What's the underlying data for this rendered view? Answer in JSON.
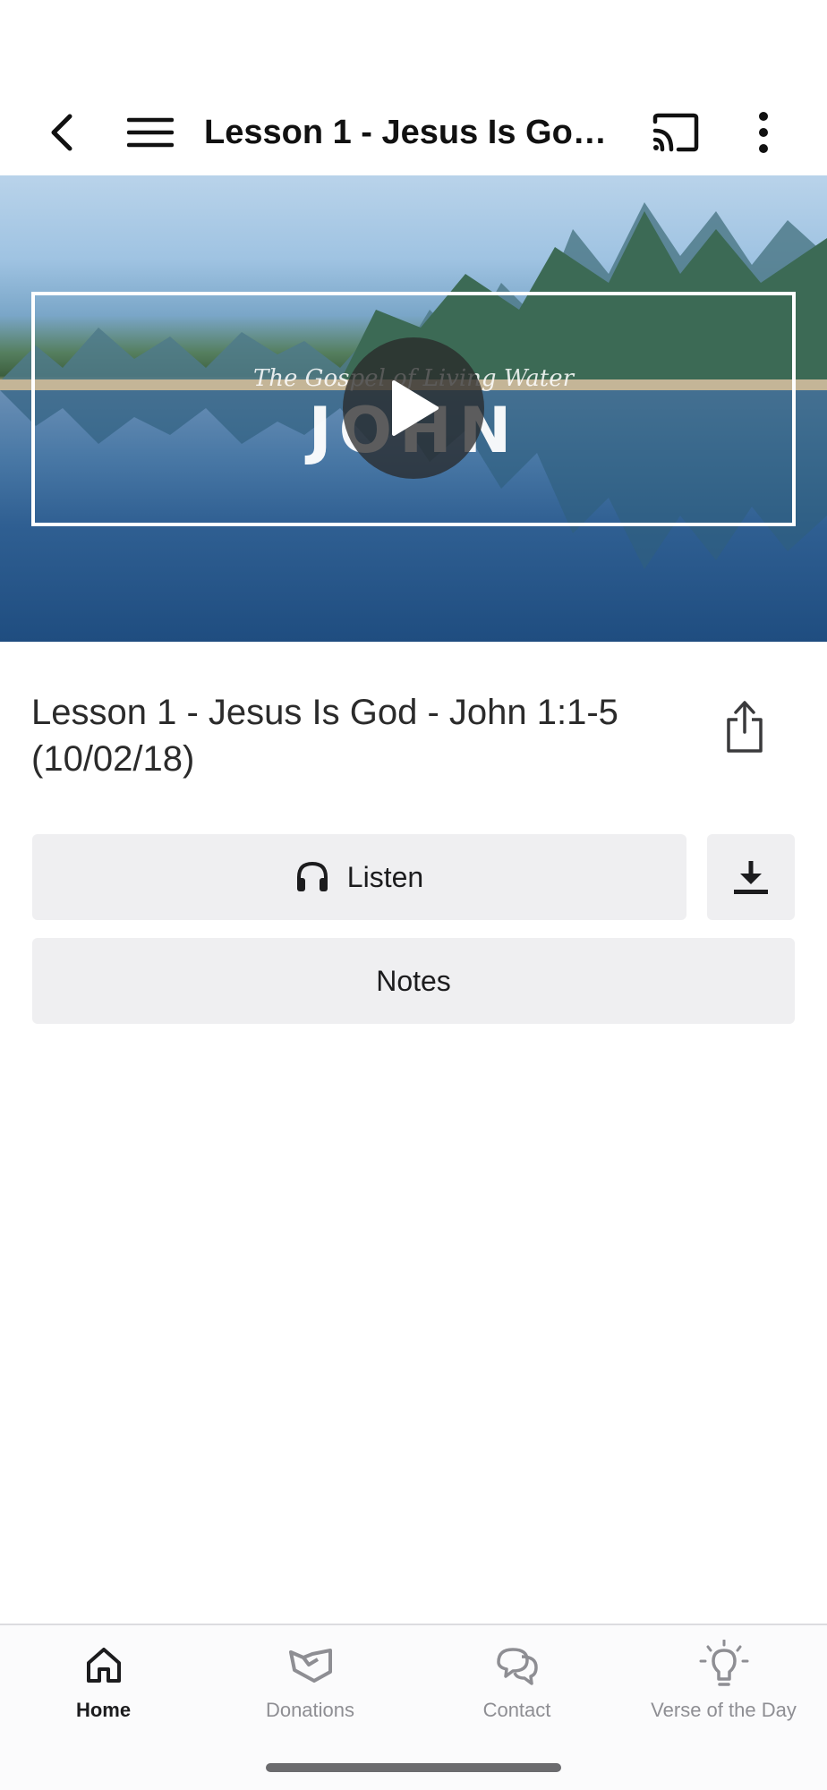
{
  "header": {
    "title": "Lesson 1 - Jesus Is God..."
  },
  "hero": {
    "subtitle": "The Gospel of Living Water",
    "title": "JOHN"
  },
  "lesson": {
    "title": "Lesson 1 - Jesus Is God - John 1:1-5 (10/02/18)"
  },
  "actions": {
    "listen_label": "Listen",
    "notes_label": "Notes"
  },
  "tabs": [
    {
      "label": "Home",
      "icon": "home-icon",
      "active": true
    },
    {
      "label": "Donations",
      "icon": "handshake-icon",
      "active": false
    },
    {
      "label": "Contact",
      "icon": "chat-bubbles-icon",
      "active": false
    },
    {
      "label": "Verse of the Day",
      "icon": "lightbulb-icon",
      "active": false
    }
  ],
  "colors": {
    "button_bg": "#efeff1",
    "tab_active": "#1c1c1e",
    "tab_inactive": "#8e8e93"
  }
}
